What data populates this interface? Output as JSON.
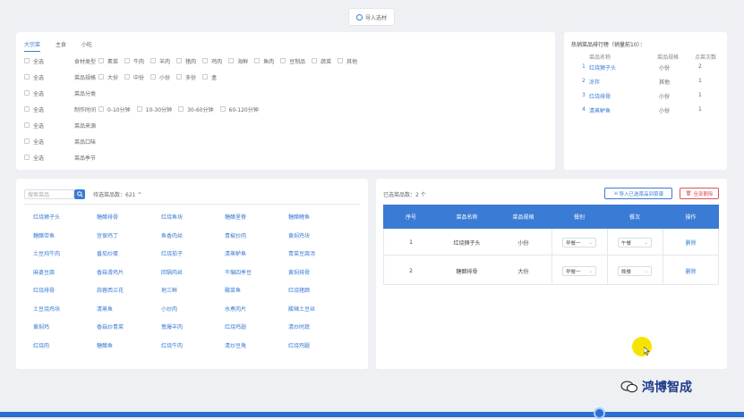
{
  "top_button": {
    "label": "导入选材"
  },
  "filter": {
    "tabs": [
      "大宗菜",
      "主食",
      "小吃"
    ],
    "all_label": "全选",
    "rows": [
      {
        "category": "食材类型",
        "options": [
          "素菜",
          "牛肉",
          "羊肉",
          "猪肉",
          "鸡肉",
          "海鲜",
          "鱼肉",
          "豆制品",
          "蔬菜",
          "其他"
        ]
      },
      {
        "category": "菜品规格",
        "options": [
          "大份",
          "中份",
          "小份",
          "多份",
          "盒"
        ]
      },
      {
        "category": "菜品分类",
        "options": []
      },
      {
        "category": "制作时间",
        "options": [
          "0-10分钟",
          "10-30分钟",
          "30-60分钟",
          "60-120分钟"
        ]
      },
      {
        "category": "菜品来源",
        "options": []
      },
      {
        "category": "菜品口味",
        "options": []
      },
      {
        "category": "菜品季节",
        "options": []
      }
    ]
  },
  "ranking": {
    "title": "热销菜品排行榜（销量前10）：",
    "headers": [
      "菜品名称",
      "菜品规格",
      "点菜次数"
    ],
    "rows": [
      {
        "rank": "1",
        "name": "红烧狮子头",
        "spec": "小份",
        "count": "2"
      },
      {
        "rank": "2",
        "name": "凉拌",
        "spec": "其他",
        "count": "1"
      },
      {
        "rank": "3",
        "name": "红烧排骨",
        "spec": "小份",
        "count": "1"
      },
      {
        "rank": "4",
        "name": "清蒸鲈鱼",
        "spec": "小份",
        "count": "1"
      }
    ]
  },
  "dish_list": {
    "search_placeholder": "搜索菜品",
    "count_label": "待选菜品数：621 ^",
    "items": [
      [
        "红烧狮子头",
        "糖醋排骨",
        "红烧鱼块",
        "糖醋里脊",
        "糖醋鲤鱼"
      ],
      [
        "糖醋带鱼",
        "宫保鸡丁",
        "鱼香肉丝",
        "青椒炒肉",
        "黄焖鸡块"
      ],
      [
        "土豆炖牛肉",
        "番茄炒蛋",
        "红烧茄子",
        "清蒸鲈鱼",
        "青菜豆腐汤"
      ],
      [
        "麻婆豆腐",
        "香菇滑鸡片",
        "回锅肉丝",
        "干煸四季豆",
        "黄焖排骨"
      ],
      [
        "红烧排骨",
        "蒜蓉西兰花",
        "地三鲜",
        "酸菜鱼",
        "红烧猪蹄"
      ],
      [
        "土豆烧鸡块",
        "清蒸鱼",
        "小炒肉",
        "水煮肉片",
        "酸辣土豆丝"
      ],
      [
        "黄焖鸡",
        "香菇炒青菜",
        "葱爆羊肉",
        "红烧鸡翅",
        "清炒时蔬"
      ],
      [
        "红烧肉",
        "糖醋鱼",
        "红烧牛肉",
        "清炒豆角",
        "红烧鸡腿"
      ]
    ]
  },
  "selected": {
    "count_label": "已选菜品数：2 个",
    "import_button": "导入已选菜品到菜谱",
    "delete_button": "全部删除",
    "headers": [
      "序号",
      "菜品名称",
      "菜品规格",
      "餐别",
      "餐次",
      "操作"
    ],
    "rows": [
      {
        "index": "1",
        "name": "红烧狮子头",
        "spec": "小份",
        "meal": "早餐一",
        "time": "午餐",
        "action": "删除"
      },
      {
        "index": "2",
        "name": "糖醋排骨",
        "spec": "大份",
        "meal": "早餐一",
        "time": "晚餐",
        "action": "删除"
      }
    ]
  },
  "watermark": {
    "brand": "鸿博智成"
  },
  "colors": {
    "accent": "#3a7bd5",
    "danger": "#e0505a",
    "cursor": "#f5e400"
  }
}
